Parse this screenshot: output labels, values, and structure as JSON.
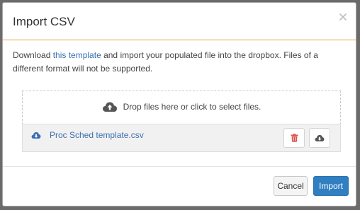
{
  "modal": {
    "title": "Import CSV",
    "close_label": "×"
  },
  "intro": {
    "text_before": "Download ",
    "link_text": "this template",
    "text_after": " and import your populated file into the dropbox. Files of a different format will not be supported."
  },
  "dropzone": {
    "icon": "cloud-upload-icon",
    "text": "Drop files here or click to select files."
  },
  "file": {
    "icon": "cloud-download-icon",
    "name": "Proc Sched template.csv",
    "delete_icon": "trash-icon",
    "download_icon": "cloud-download-icon"
  },
  "footer": {
    "cancel_label": "Cancel",
    "import_label": "Import"
  },
  "colors": {
    "accent_line": "#e5a14a",
    "link": "#3a6fb0",
    "primary_button": "#2f7fc1",
    "delete_icon": "#d9534f"
  }
}
